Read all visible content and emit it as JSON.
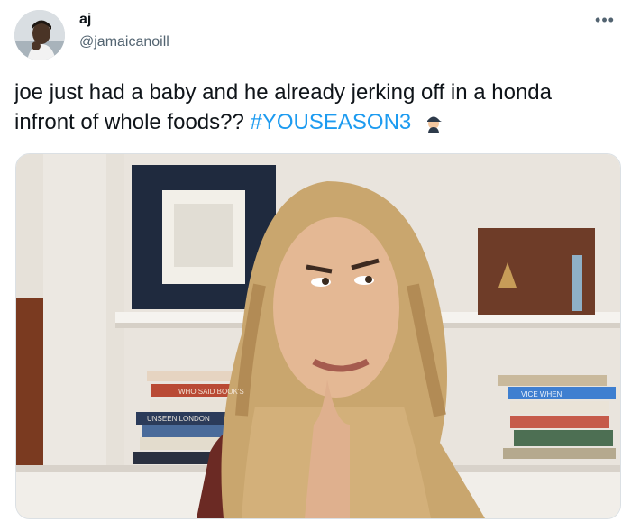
{
  "tweet": {
    "author": {
      "display_name": "aj",
      "handle": "@jamaicanoill"
    },
    "more_icon": "more-horizontal-icon",
    "text": "joe just had a baby and he already jerking off in a honda infront of whole foods??",
    "hashtag": "#YOUSEASON3",
    "emoji": "cap-man-emoji",
    "media": {
      "type": "photo",
      "book_spines": [
        "WHO SAID BOOK'S",
        "UNSEEN LONDON",
        "VICE WHEN"
      ]
    }
  },
  "colors": {
    "link": "#1d9bf0",
    "text": "#0f1419",
    "muted": "#536471"
  }
}
